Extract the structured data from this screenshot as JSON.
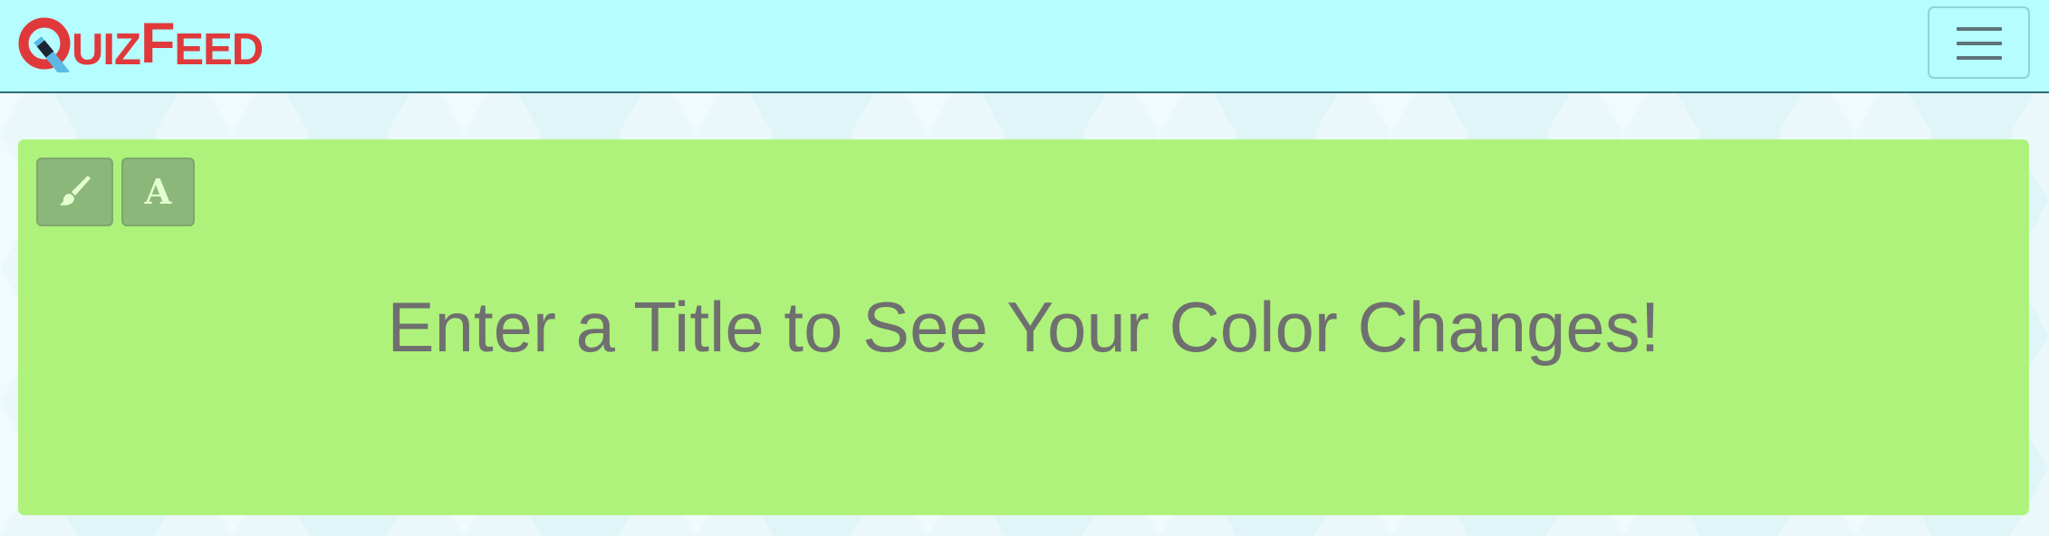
{
  "navbar": {
    "logo": {
      "q": "Q",
      "uiz": "UIZ",
      "f": "F",
      "eed": "EED"
    },
    "menu_toggle_icon": "hamburger-menu-icon"
  },
  "banner": {
    "background_color": "#aef27b",
    "tools": [
      {
        "icon": "paintbrush-icon"
      },
      {
        "icon": "font-icon",
        "glyph": "A"
      }
    ],
    "title": "Enter a Title to See Your Color Changes!"
  },
  "colors": {
    "navbar_bg": "#b5fdfe",
    "logo_red": "#e0393b",
    "logo_blue": "#5bb9e6",
    "title_text": "#6f6f6f",
    "button_bg": "#8cb77a"
  }
}
